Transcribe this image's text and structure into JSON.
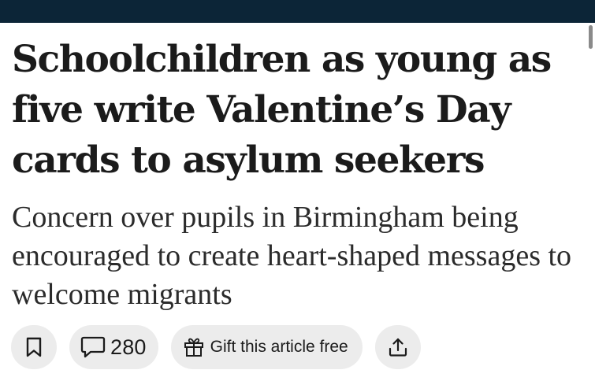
{
  "article": {
    "headline": "Schoolchildren as young as five write Valentine’s Day cards to asylum seekers",
    "standfirst": "Concern over pupils in Birmingham being encouraged to create heart-shaped messages to welcome migrants"
  },
  "actions": {
    "bookmark_icon": "bookmark-icon",
    "comments_icon": "speech-bubble-icon",
    "comment_count": "280",
    "gift_icon": "gift-icon",
    "gift_label": "Gift this article free",
    "share_icon": "share-upload-icon"
  },
  "colors": {
    "top_bar": "#0c2537",
    "pill_background": "#ececec",
    "text": "#1b1b1b"
  }
}
